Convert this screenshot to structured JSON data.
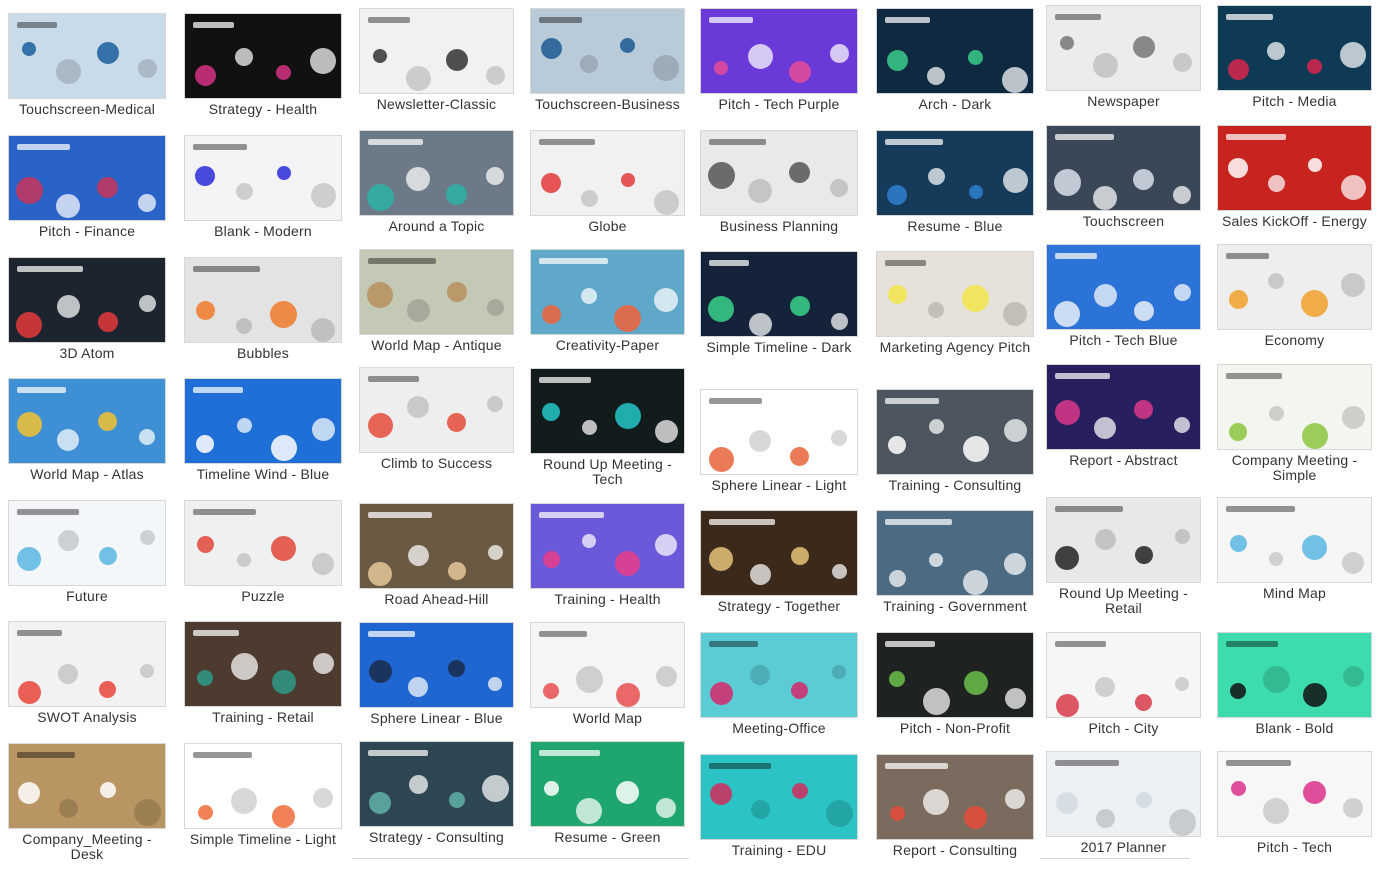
{
  "columns": [
    {
      "items": [
        {
          "label": "Touchscreen-Medical",
          "bg": "#c9dbe9",
          "accent": "#1b5f9e",
          "dark": false
        },
        {
          "label": "Pitch - Finance",
          "bg": "#2a63c8",
          "accent": "#c9345a",
          "dark": true
        },
        {
          "label": "3D Atom",
          "bg": "#1c2430",
          "accent": "#e43a3a",
          "dark": true
        },
        {
          "label": "World Map - Atlas",
          "bg": "#3f8fd4",
          "accent": "#f2c230",
          "dark": true
        },
        {
          "label": "Future",
          "bg": "#f4f7fa",
          "accent": "#59b7e3",
          "dark": false
        },
        {
          "label": "SWOT Analysis",
          "bg": "#f2f2f2",
          "accent": "#e8443a",
          "dark": false
        },
        {
          "label": "Company_Meeting - Desk",
          "bg": "#b99563",
          "accent": "#ffffff",
          "dark": false
        }
      ]
    },
    {
      "items": [
        {
          "label": "Strategy - Health",
          "bg": "#111111",
          "accent": "#d63384",
          "dark": true
        },
        {
          "label": "Blank - Modern",
          "bg": "#f4f4f6",
          "accent": "#2a2ad8",
          "dark": false
        },
        {
          "label": "Bubbles",
          "bg": "#e3e3e3",
          "accent": "#f07a2a",
          "dark": false
        },
        {
          "label": "Timeline Wind - Blue",
          "bg": "#1f6fd6",
          "accent": "#ffffff",
          "dark": true
        },
        {
          "label": "Puzzle",
          "bg": "#eef0f2",
          "accent": "#e2473a",
          "dark": false
        },
        {
          "label": "Training - Retail",
          "bg": "#4c3b2e",
          "accent": "#2f9a8a",
          "dark": true
        },
        {
          "label": "Simple Timeline - Light",
          "bg": "#ffffff",
          "accent": "#ef6b3a",
          "dark": false
        }
      ]
    },
    {
      "items": [
        {
          "label": "Newsletter-Classic",
          "bg": "#f1f1f1",
          "accent": "#333333",
          "dark": false
        },
        {
          "label": "Around a Topic",
          "bg": "#6b7a86",
          "accent": "#2cb3a6",
          "dark": true
        },
        {
          "label": "World Map - Antique",
          "bg": "#c4c9b6",
          "accent": "#b78f5d",
          "dark": false
        },
        {
          "label": "Climb to Success",
          "bg": "#eeeeee",
          "accent": "#e34b3a",
          "dark": false
        },
        {
          "label": "Road Ahead-Hill",
          "bg": "#6b5a43",
          "accent": "#e6c79a",
          "dark": true
        },
        {
          "label": "Sphere Linear - Blue",
          "bg": "#1f66d1",
          "accent": "#1b2b4a",
          "dark": true
        },
        {
          "label": "Strategy - Consulting",
          "bg": "#2e4552",
          "accent": "#5fb3a8",
          "dark": true
        }
      ]
    },
    {
      "items": [
        {
          "label": "Touchscreen-Business",
          "bg": "#b9cad8",
          "accent": "#1c5a92",
          "dark": false
        },
        {
          "label": "Globe",
          "bg": "#f1f1f1",
          "accent": "#e33a3a",
          "dark": false
        },
        {
          "label": "Creativity-Paper",
          "bg": "#5fa8c9",
          "accent": "#f0633a",
          "dark": true
        },
        {
          "label": "Round Up Meeting - Tech",
          "bg": "#121c1c",
          "accent": "#22c7c7",
          "dark": true
        },
        {
          "label": "Training - Health",
          "bg": "#6a5ad9",
          "accent": "#e93d88",
          "dark": true
        },
        {
          "label": "World Map",
          "bg": "#f5f5f5",
          "accent": "#e94f4f",
          "dark": false
        },
        {
          "label": "Resume - Green",
          "bg": "#1fa56e",
          "accent": "#ffffff",
          "dark": true
        }
      ]
    },
    {
      "items": [
        {
          "label": "Pitch - Tech Purple",
          "bg": "#6a3ad8",
          "accent": "#e44c9a",
          "dark": true
        },
        {
          "label": "Business Planning",
          "bg": "#e9e9e9",
          "accent": "#555555",
          "dark": false
        },
        {
          "label": "Simple Timeline - Dark",
          "bg": "#14233a",
          "accent": "#3ad18a",
          "dark": true
        },
        {
          "label": "Sphere Linear - Light",
          "bg": "#ffffff",
          "accent": "#e8643a",
          "dark": false
        },
        {
          "label": "Strategy - Together",
          "bg": "#3b2a1c",
          "accent": "#e8c278",
          "dark": true
        },
        {
          "label": "Meeting-Office",
          "bg": "#5bcbd6",
          "accent": "#d6286a",
          "dark": false
        },
        {
          "label": "Training - EDU",
          "bg": "#2bc3c3",
          "accent": "#d22a5c",
          "dark": false
        }
      ]
    },
    {
      "items": [
        {
          "label": "Arch - Dark",
          "bg": "#0f2a40",
          "accent": "#3acb8a",
          "dark": true
        },
        {
          "label": "Resume - Blue",
          "bg": "#153a5a",
          "accent": "#2f7fd0",
          "dark": true
        },
        {
          "label": "Marketing Agency Pitch",
          "bg": "#e6e2da",
          "accent": "#f2e54a",
          "dark": false
        },
        {
          "label": "Training - Consulting",
          "bg": "#4d5660",
          "accent": "#ffffff",
          "dark": true
        },
        {
          "label": "Training - Government",
          "bg": "#4c6b82",
          "accent": "#e1e6ea",
          "dark": true
        },
        {
          "label": "Pitch - Non-Profit",
          "bg": "#1e2220",
          "accent": "#6cc04a",
          "dark": true
        },
        {
          "label": "Report - Consulting",
          "bg": "#7a6b5e",
          "accent": "#e64a3a",
          "dark": true
        }
      ]
    },
    {
      "items": [
        {
          "label": "Newspaper",
          "bg": "#ececec",
          "accent": "#777777",
          "dark": false
        },
        {
          "label": "Touchscreen",
          "bg": "#394756",
          "accent": "#d9e2ea",
          "dark": true
        },
        {
          "label": "Pitch - Tech Blue",
          "bg": "#2b73d6",
          "accent": "#e8eef8",
          "dark": true
        },
        {
          "label": "Report - Abstract",
          "bg": "#281f5e",
          "accent": "#d93a8a",
          "dark": true
        },
        {
          "label": "Round Up Meeting - Retail",
          "bg": "#e8e8e8",
          "accent": "#222222",
          "dark": false
        },
        {
          "label": "Pitch - City",
          "bg": "#f6f6f6",
          "accent": "#d83a4a",
          "dark": false
        },
        {
          "label": "2017 Planner",
          "bg": "#eef1f4",
          "accent": "#d2d9e0",
          "dark": false
        }
      ]
    },
    {
      "items": [
        {
          "label": "Pitch - Media",
          "bg": "#0e3a56",
          "accent": "#d8264c",
          "dark": true
        },
        {
          "label": "Sales KickOff - Energy",
          "bg": "#c7231f",
          "accent": "#ffffff",
          "dark": true
        },
        {
          "label": "Economy",
          "bg": "#eeeeee",
          "accent": "#f0a02a",
          "dark": false
        },
        {
          "label": "Company Meeting - Simple",
          "bg": "#f3f6ef",
          "accent": "#8cc63f",
          "dark": false
        },
        {
          "label": "Mind Map",
          "bg": "#f6f6f6",
          "accent": "#59b7e3",
          "dark": false
        },
        {
          "label": "Blank - Bold",
          "bg": "#3ddcae",
          "accent": "#111111",
          "dark": false
        },
        {
          "label": "Pitch - Tech",
          "bg": "#f7f7f7",
          "accent": "#d9308a",
          "dark": false
        }
      ]
    }
  ]
}
